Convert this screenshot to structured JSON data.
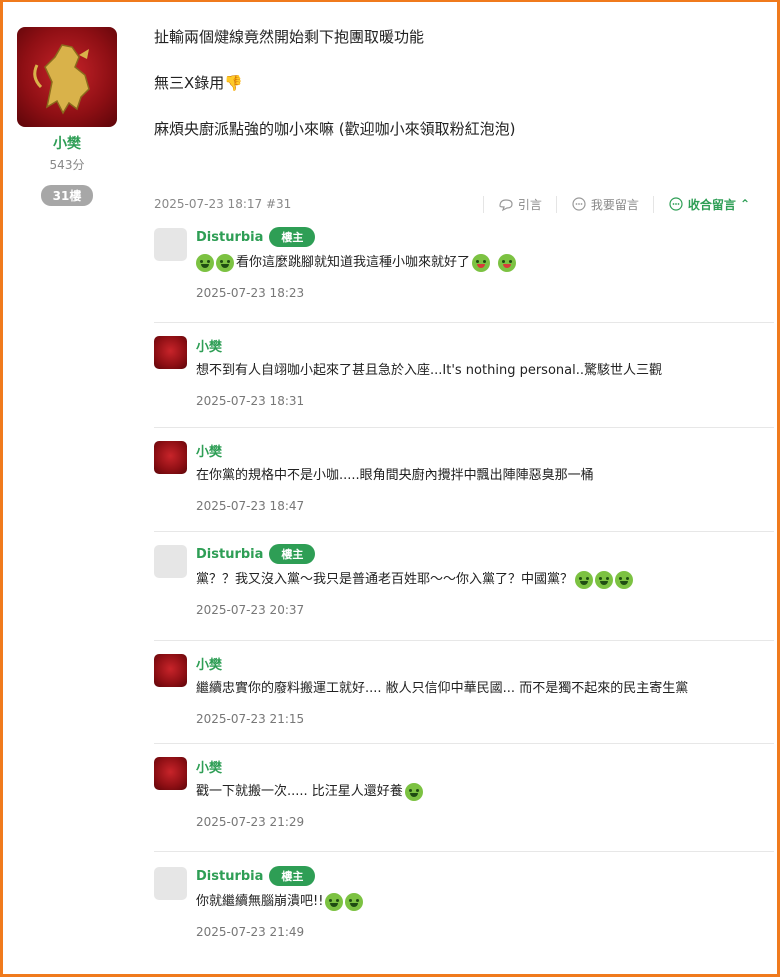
{
  "author": {
    "name": "小樊",
    "score": "543分",
    "floor": "31樓"
  },
  "post": {
    "lines": [
      "扯輸兩個煡線竟然開始剩下抱團取暖功能",
      "無三X錄用",
      "麻煩央廚派點強的咖小來嘛 (歡迎咖小來領取粉紅泡泡)"
    ],
    "datetime": "2025-07-23 18:17 #31",
    "actions": {
      "quote": "引言",
      "reply": "我要留言",
      "collapse": "收合留言"
    }
  },
  "comments": [
    {
      "name": "Disturbia",
      "badge": "樓主",
      "avatar": "default",
      "text": "看你這麼跳腳就知道我這種小咖來就好了",
      "time": "2025-07-23 18:23"
    },
    {
      "name": "小樊",
      "badge": "",
      "avatar": "lion",
      "text": "想不到有人自翊咖小起來了甚且急於入座...It's nothing personal..驚駭世人三觀",
      "time": "2025-07-23 18:31"
    },
    {
      "name": "小樊",
      "badge": "",
      "avatar": "lion",
      "text": "在你黨的規格中不是小咖.....眼角間央廚內攪拌中飄出陣陣惡臭那一桶",
      "time": "2025-07-23 18:47"
    },
    {
      "name": "Disturbia",
      "badge": "樓主",
      "avatar": "default",
      "text": "黨？？我又沒入黨～我只是普通老百姓耶～～你入黨了？中國黨？",
      "time": "2025-07-23 20:37"
    },
    {
      "name": "小樊",
      "badge": "",
      "avatar": "lion",
      "text": "繼續忠實你的廢料搬運工就好.... 敝人只信仰中華民國... 而不是獨不起來的民主寄生黨",
      "time": "2025-07-23 21:15"
    },
    {
      "name": "小樊",
      "badge": "",
      "avatar": "lion",
      "text": "戳一下就搬一次..... 比汪星人還好養",
      "time": "2025-07-23 21:29"
    },
    {
      "name": "Disturbia",
      "badge": "樓主",
      "avatar": "default",
      "text": "你就繼續無腦崩潰吧!!",
      "time": "2025-07-23 21:49"
    }
  ]
}
